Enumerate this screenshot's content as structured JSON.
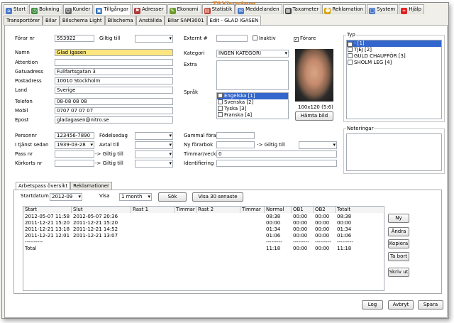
{
  "brand": {
    "name": "TAXIsystem"
  },
  "tabs": [
    {
      "label": "Start",
      "icon": "home-icon",
      "color": "#4a78c8"
    },
    {
      "label": "Bokning",
      "icon": "clock-icon",
      "color": "#3c8c3c"
    },
    {
      "label": "Kunder",
      "icon": "people-icon",
      "color": "#666"
    },
    {
      "label": "Tillgångar",
      "icon": "cars-icon",
      "color": "#2d6fb7"
    },
    {
      "label": "Adresser",
      "icon": "flag-icon",
      "color": "#b03a3a"
    },
    {
      "label": "Ekonomi",
      "icon": "pencil-icon",
      "color": "#6a9a2a"
    },
    {
      "label": "Statistik",
      "icon": "chart-icon",
      "color": "#b43"
    },
    {
      "label": "Meddelanden",
      "icon": "chat-icon",
      "color": "#4a78c8"
    },
    {
      "label": "Taxameter",
      "icon": "meter-icon",
      "color": "#444"
    },
    {
      "label": "Reklamation",
      "icon": "face-icon",
      "color": "#d6a000"
    },
    {
      "label": "System",
      "icon": "window-icon",
      "color": "#4a78c8"
    },
    {
      "label": "Hjälp",
      "icon": "plus-icon",
      "color": "#d22"
    }
  ],
  "subtabs": [
    "Transportörer",
    "Bilar",
    "Bilschema Light",
    "Bilschema",
    "Anställda",
    "Bilar SAM3001",
    "Edit - GLAD IGASEN"
  ],
  "form": {
    "forar_nr_label": "Förar nr",
    "forar_nr": "553922",
    "giltig_till_label": "Giltig till",
    "namn_label": "Namn",
    "namn": "Glad Igasen",
    "attention_label": "Attention",
    "gatuadress_label": "Gatuadress",
    "gatuadress": "Fullfartsgatan 3",
    "postadress_label": "Postadress",
    "postadress": "10010 Stockholm",
    "land_label": "Land",
    "land": "Sverige",
    "telefon_label": "Telefon",
    "telefon": "08-08 08 08",
    "mobil_label": "Mobil",
    "mobil": "0707 07 07 07",
    "epost_label": "Epost",
    "epost": "gladagasen@nitro.se",
    "personnr_label": "Personnr",
    "personnr": "123456-7890",
    "fodelsedag_label": "Födelsedag",
    "i_tjanst_label": "I tjänst sedan",
    "i_tjanst": "1939-03-28",
    "avtal_label": "Avtal till",
    "pass_label": "Pass nr",
    "pass_giltig_label": "-> Giltig till",
    "korkort_label": "Körkorts nr",
    "korkort_giltig_label": "-> Giltig till",
    "externt_label": "Externt #",
    "inaktiv_label": "Inaktiv",
    "forare_label": "Förare",
    "kategori_label": "Kategori",
    "kategori": "INGEN KATEGORI",
    "extra_label": "Extra",
    "sprak_label": "Språk",
    "sprak_items": [
      "Engelska [1]",
      "Svenska [2]",
      "Tyska [3]",
      "Franska [4]"
    ],
    "photo_size": "100x120 (5:6)",
    "hamta_bild": "Hämta bild",
    "gammal_label": "Gammal förarbok",
    "ny_label": "Ny förarbok",
    "ny_giltig_label": "-> Giltig till",
    "timmar_label": "Timmar/vecka",
    "timmar": "0",
    "identifiering_label": "Identifiering"
  },
  "typ": {
    "title": "Typ",
    "items": [
      "- [1]",
      "TJEJ [2]",
      "GULD CHAUFFÖR [3]",
      "SHOLM LEG [4]"
    ]
  },
  "noteringar": {
    "title": "Noteringar"
  },
  "bottom": {
    "tabs": [
      "Arbetspass översikt",
      "Reklamationer"
    ],
    "startdatum_label": "Startdatum",
    "startdatum": "2012-09",
    "visa_label": "Visa",
    "visa": "1 month",
    "sok": "Sök",
    "visa30": "Visa 30 senaste",
    "headers": [
      "Start",
      "Slut",
      "Rast 1",
      "Timmar",
      "Rast 2",
      "Timmar",
      "Normal",
      "OB1",
      "OB2",
      "Totalt"
    ],
    "rows": [
      [
        "2012-05-07 11:58",
        "2012-05-07 20:36",
        "",
        "",
        "",
        "",
        "08:38",
        "00:00",
        "00:00",
        "08:38"
      ],
      [
        "2011-12-21 15:20",
        "2011-12-21 15:20",
        "",
        "",
        "",
        "",
        "00:00",
        "00:00",
        "00:00",
        "00:00"
      ],
      [
        "2011-12-21 13:18",
        "2011-12-21 14:52",
        "",
        "",
        "",
        "",
        "01:34",
        "00:00",
        "00:00",
        "01:34"
      ],
      [
        "2011-12-21 12:01",
        "2011-12-21 13:07",
        "",
        "",
        "",
        "",
        "01:06",
        "00:00",
        "00:00",
        "01:06"
      ],
      [
        "----------",
        "",
        "",
        "",
        "",
        "",
        "---------",
        "---------",
        "---------",
        "---------"
      ],
      [
        "Total",
        "",
        "",
        "",
        "",
        "",
        "11:18",
        "00:00",
        "00:00",
        "11:18"
      ]
    ],
    "side_buttons": [
      "Ny",
      "Ändra",
      "Kopiera",
      "Ta bort",
      "Skriv ut"
    ]
  },
  "footer": {
    "log": "Log",
    "avbryt": "Avbryt",
    "spara": "Spara"
  }
}
